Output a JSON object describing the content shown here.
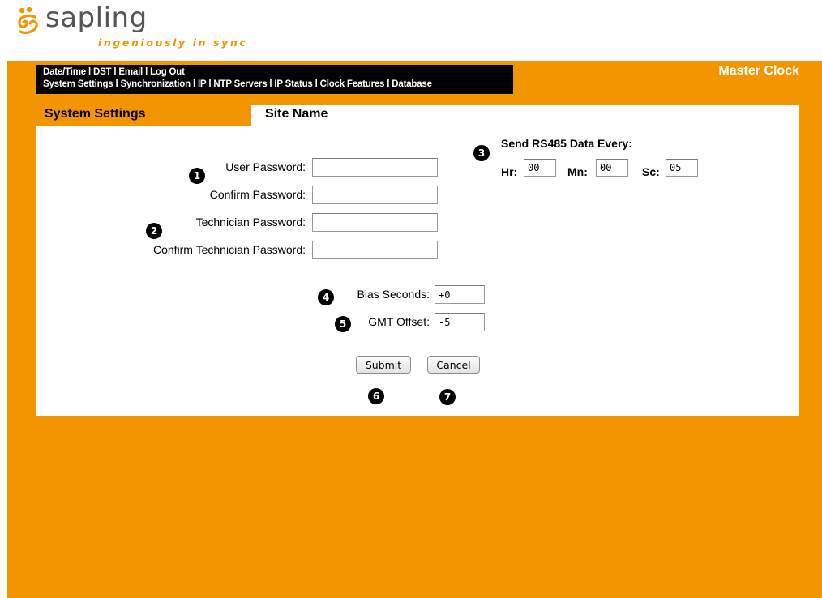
{
  "logo": {
    "name": "sapling",
    "tagline": "ingeniously in sync",
    "icon": "sapling-swirl-logo",
    "brand_color": "#f39500"
  },
  "nav": {
    "row1": [
      "Date/Time",
      "DST",
      "Email",
      "Log Out"
    ],
    "row2": [
      "System Settings",
      "Synchronization",
      "IP",
      "NTP Servers",
      "IP Status",
      "Clock Features",
      "Database"
    ],
    "separator": "l"
  },
  "header": {
    "title": "Master Clock",
    "active_tab": "System Settings",
    "section": "Site Name"
  },
  "form": {
    "user_password_label": "User Password:",
    "confirm_password_label": "Confirm Password:",
    "technician_password_label": "Technician Password:",
    "confirm_technician_password_label": "Confirm Technician Password:",
    "user_password": "",
    "confirm_password": "",
    "technician_password": "",
    "confirm_technician_password": "",
    "bias_seconds_label": "Bias Seconds:",
    "bias_seconds": "+0",
    "gmt_offset_label": "GMT Offset:",
    "gmt_offset": "-5"
  },
  "rs485": {
    "title": "Send RS485 Data Every:",
    "hr_label": "Hr:",
    "hr": "00",
    "mn_label": "Mn:",
    "mn": "00",
    "sc_label": "Sc:",
    "sc": "05"
  },
  "buttons": {
    "submit": "Submit",
    "cancel": "Cancel"
  },
  "markers": [
    "1",
    "2",
    "3",
    "4",
    "5",
    "6",
    "7"
  ]
}
